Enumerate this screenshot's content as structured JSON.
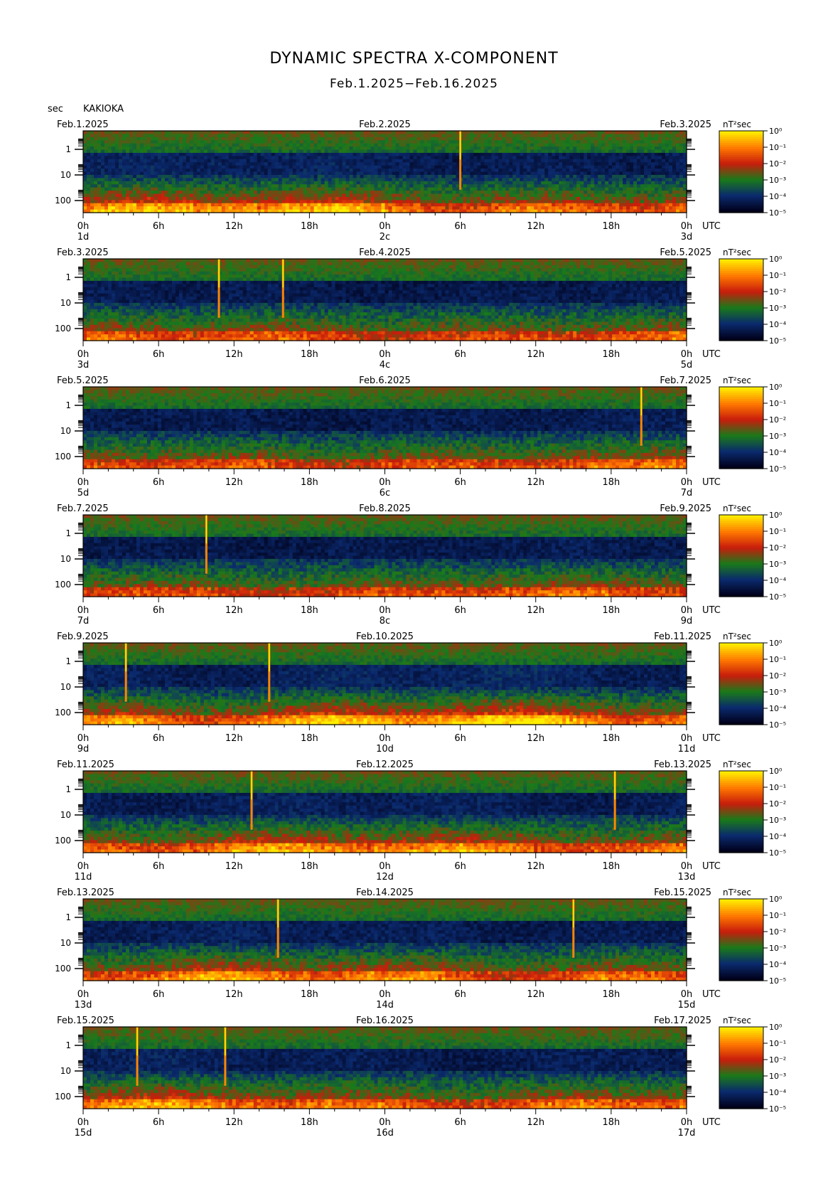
{
  "header": {
    "title": "DYNAMIC SPECTRA X-COMPONENT",
    "subtitle": "Feb.1.2025−Feb.16.2025",
    "units": "sec",
    "station": "KAKIOKA"
  },
  "chart_data": {
    "type": "heatmap",
    "y_ticks": [
      "1",
      "10",
      "100"
    ],
    "y_scale": "log",
    "time_ticks": [
      "0h",
      "6h",
      "12h",
      "18h",
      "0h",
      "6h",
      "12h",
      "18h",
      "0h"
    ],
    "utc_label": "UTC",
    "colorbar_ticks": [
      "10⁰",
      "10⁻¹",
      "10⁻²",
      "10⁻³",
      "10⁻⁴",
      "10⁻⁵"
    ],
    "colorbar_unit": "nT²sec",
    "colorscale": [
      "#000018",
      "#0b2a6e",
      "#1a7a1a",
      "#c81c0c",
      "#ff7a00",
      "#ffee00"
    ],
    "panels": [
      {
        "start_date": "Feb.1.2025",
        "mid_date": "Feb.2.2025",
        "end_date": "Feb.3.2025",
        "day_labels": [
          "1d",
          "2c",
          "3d"
        ],
        "activity": 0.55,
        "spikes_h": [
          30
        ]
      },
      {
        "start_date": "Feb.3.2025",
        "mid_date": "Feb.4.2025",
        "end_date": "Feb.5.2025",
        "day_labels": [
          "3d",
          "4c",
          "5d"
        ],
        "activity": 0.3,
        "spikes_h": [
          10.8,
          15.9
        ]
      },
      {
        "start_date": "Feb.5.2025",
        "mid_date": "Feb.6.2025",
        "end_date": "Feb.7.2025",
        "day_labels": [
          "5d",
          "6c",
          "7d"
        ],
        "activity": 0.3,
        "spikes_h": [
          44.4
        ]
      },
      {
        "start_date": "Feb.7.2025",
        "mid_date": "Feb.8.2025",
        "end_date": "Feb.9.2025",
        "day_labels": [
          "7d",
          "8c",
          "9d"
        ],
        "activity": 0.28,
        "spikes_h": [
          9.8
        ]
      },
      {
        "start_date": "Feb.9.2025",
        "mid_date": "Feb.10.2025",
        "end_date": "Feb.11.2025",
        "day_labels": [
          "9d",
          "10d",
          "11d"
        ],
        "activity": 0.65,
        "spikes_h": [
          3.4,
          14.8
        ]
      },
      {
        "start_date": "Feb.11.2025",
        "mid_date": "Feb.12.2025",
        "end_date": "Feb.13.2025",
        "day_labels": [
          "11d",
          "12d",
          "13d"
        ],
        "activity": 0.5,
        "spikes_h": [
          13.4,
          42.3
        ]
      },
      {
        "start_date": "Feb.13.2025",
        "mid_date": "Feb.14.2025",
        "end_date": "Feb.15.2025",
        "day_labels": [
          "13d",
          "14d",
          "15d"
        ],
        "activity": 0.45,
        "spikes_h": [
          15.5,
          39
        ]
      },
      {
        "start_date": "Feb.15.2025",
        "mid_date": "Feb.16.2025",
        "end_date": "Feb.17.2025",
        "day_labels": [
          "15d",
          "16d",
          "17d"
        ],
        "activity": 0.45,
        "spikes_h": [
          4.3,
          11.3
        ]
      }
    ]
  }
}
